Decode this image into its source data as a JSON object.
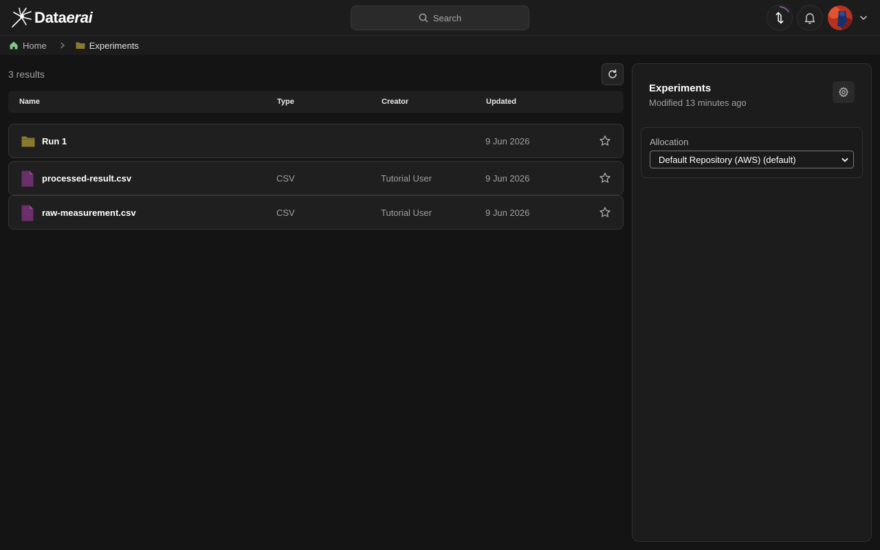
{
  "app": {
    "logo_text_regular": "Data",
    "logo_text_italic": "erai"
  },
  "header": {
    "search_placeholder": "Search"
  },
  "breadcrumb": {
    "home": "Home",
    "current": "Experiments"
  },
  "results": {
    "count_label": "3 results",
    "columns": [
      "Name",
      "Type",
      "Creator",
      "Updated"
    ],
    "rows": [
      {
        "name": "Run 1",
        "kind": "folder",
        "type": "",
        "creator": "",
        "updated": "9 Jun 2026"
      },
      {
        "name": "processed-result.csv",
        "kind": "file",
        "type": "CSV",
        "creator": "Tutorial User",
        "updated": "9 Jun 2026"
      },
      {
        "name": "raw-measurement.csv",
        "kind": "file",
        "type": "CSV",
        "creator": "Tutorial User",
        "updated": "9 Jun 2026"
      }
    ]
  },
  "panel": {
    "title": "Experiments",
    "subtitle": "Modified 13 minutes ago",
    "allocation_label": "Allocation",
    "allocation_value": "Default Repository (AWS) (default)"
  },
  "colors": {
    "background": "#141414",
    "folder": "#8a7a2e",
    "file": "#6b2f6b",
    "home_icon": "#7fc98a"
  },
  "icons": {
    "logo": "sparkle-burst-icon",
    "search": "search-icon",
    "sync": "sync-icon",
    "notifications": "bell-icon",
    "avatar_menu": "chevron-down-icon",
    "home": "home-icon",
    "breadcrumb_sep": "chevron-right-icon",
    "folder": "folder-icon",
    "file": "file-icon",
    "refresh": "refresh-icon",
    "favorite": "star-icon",
    "settings": "gear-icon"
  }
}
